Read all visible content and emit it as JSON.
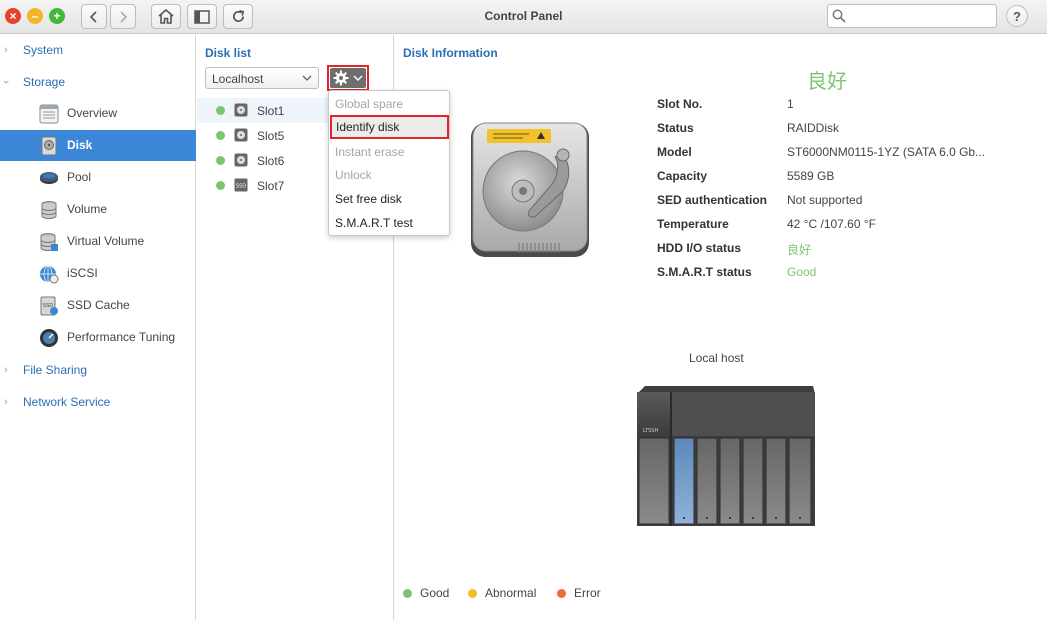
{
  "window": {
    "title": "Control Panel",
    "search_placeholder": ""
  },
  "sidebar": {
    "categories": [
      {
        "label": "System"
      },
      {
        "label": "Storage"
      },
      {
        "label": "File Sharing"
      },
      {
        "label": "Network Service"
      }
    ],
    "storage_items": [
      {
        "label": "Overview",
        "icon": "overview-icon"
      },
      {
        "label": "Disk",
        "icon": "disk-icon",
        "active": true
      },
      {
        "label": "Pool",
        "icon": "pool-icon"
      },
      {
        "label": "Volume",
        "icon": "volume-icon"
      },
      {
        "label": "Virtual Volume",
        "icon": "virtual-volume-icon"
      },
      {
        "label": "iSCSI",
        "icon": "iscsi-icon"
      },
      {
        "label": "SSD Cache",
        "icon": "ssd-cache-icon"
      },
      {
        "label": "Performance Tuning",
        "icon": "performance-tuning-icon"
      }
    ]
  },
  "disk_list": {
    "title": "Disk list",
    "host_select": "Localhost",
    "slots": [
      {
        "label": "Slot1",
        "type": "hdd",
        "status": "Good"
      },
      {
        "label": "Slot5",
        "type": "hdd",
        "status": "Good"
      },
      {
        "label": "Slot6",
        "type": "hdd",
        "status": "Good"
      },
      {
        "label": "Slot7",
        "type": "ssd",
        "status": "Good",
        "badge": "SSD"
      }
    ]
  },
  "action_menu": {
    "items": [
      {
        "label": "Global spare",
        "enabled": false
      },
      {
        "label": "Identify disk",
        "enabled": true,
        "highlighted": true
      },
      {
        "label": "Instant erase",
        "enabled": false
      },
      {
        "label": "Unlock",
        "enabled": false
      },
      {
        "label": "Set free disk",
        "enabled": true
      },
      {
        "label": "S.M.A.R.T test",
        "enabled": true
      }
    ]
  },
  "disk_info": {
    "title": "Disk Information",
    "health": "良好",
    "fields": [
      {
        "label": "Slot No.",
        "value": "1"
      },
      {
        "label": "Status",
        "value": "RAIDDisk"
      },
      {
        "label": "Model",
        "value": "ST6000NM0115-1YZ (SATA 6.0 Gb..."
      },
      {
        "label": "Capacity",
        "value": "5589 GB"
      },
      {
        "label": "SED authentication",
        "value": "Not supported"
      },
      {
        "label": "Temperature",
        "value": "42 °C /107.60 °F"
      },
      {
        "label": "HDD I/O status",
        "value": "良好"
      },
      {
        "label": "S.M.A.R.T status",
        "value": "Good"
      }
    ],
    "host_label": "Local host",
    "nas_badge": "LTSSH",
    "legend": [
      {
        "label": "Good",
        "color": "#7dc470"
      },
      {
        "label": "Abnormal",
        "color": "#f5b92c"
      },
      {
        "label": "Error",
        "color": "#ef6a3b"
      }
    ]
  },
  "colors": {
    "accent": "#3b86d6",
    "link": "#2a6fb5",
    "good": "#7dc470",
    "highlight_border": "#e0262a"
  }
}
